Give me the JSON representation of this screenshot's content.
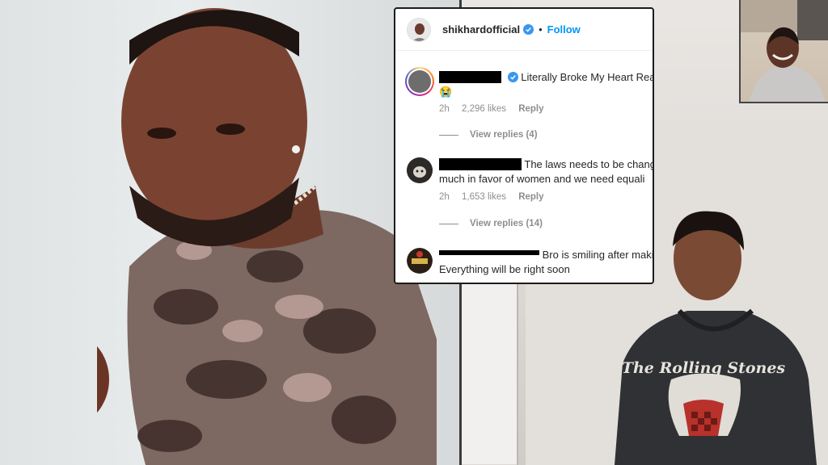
{
  "post": {
    "username": "shikhardofficial",
    "separator": "•",
    "follow_label": "Follow"
  },
  "comments": [
    {
      "text": "Literally Broke My Heart Read",
      "emoji": "😭",
      "time": "2h",
      "likes": "2,296 likes",
      "reply_label": "Reply",
      "view_replies": "View replies (4)"
    },
    {
      "text": "The laws needs to be chang",
      "text_line2": "much in favor of women and we need equali",
      "time": "2h",
      "likes": "1,653 likes",
      "reply_label": "Reply",
      "view_replies": "View replies (14)"
    },
    {
      "text": "Bro is smiling after maki",
      "text_line2": "Everything will be right soon"
    }
  ],
  "hoodie_text": "The Rolling Stones",
  "colors": {
    "follow": "#0095f6",
    "verified": "#3897f0",
    "muted": "#8e8e8e",
    "redaction": "#000000"
  },
  "icons": [
    "verified-badge-icon",
    "crying-face-emoji"
  ]
}
